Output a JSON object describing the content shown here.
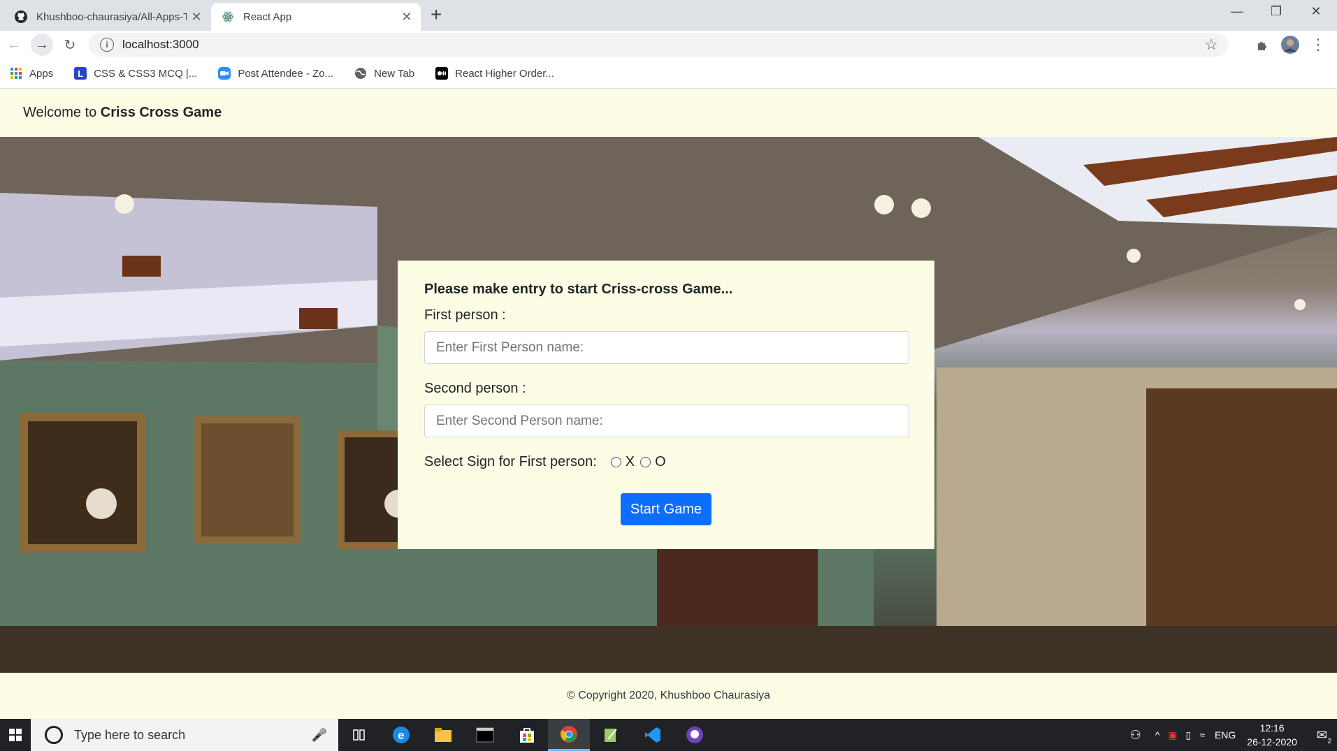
{
  "browser": {
    "tabs": [
      {
        "title": "Khushboo-chaurasiya/All-Apps-T",
        "active": false
      },
      {
        "title": "React App",
        "active": true
      }
    ],
    "url": "localhost:3000",
    "bookmarks": [
      {
        "label": "Apps",
        "icon": "apps-grid-icon"
      },
      {
        "label": "CSS & CSS3 MCQ |...",
        "icon": "l-logo-icon"
      },
      {
        "label": "Post Attendee - Zo...",
        "icon": "zoom-icon"
      },
      {
        "label": "New Tab",
        "icon": "globe-icon"
      },
      {
        "label": "React Higher Order...",
        "icon": "medium-icon"
      }
    ]
  },
  "header": {
    "welcome_prefix": "Welcome to ",
    "game_name": "Criss Cross Game"
  },
  "form": {
    "heading": "Please make entry to start Criss-cross Game...",
    "first_label": "First person :",
    "first_placeholder": "Enter First Person name:",
    "first_value": "",
    "second_label": "Second person :",
    "second_placeholder": "Enter Second Person name:",
    "second_value": "",
    "sign_label": "Select Sign for First person:",
    "sign_options": [
      "X",
      "O"
    ],
    "start_button": "Start Game"
  },
  "footer": {
    "copyright": "© Copyright 2020, Khushboo Chaurasiya"
  },
  "taskbar": {
    "search_placeholder": "Type here to search",
    "language": "ENG",
    "time": "12:16",
    "date": "26-12-2020",
    "notification_count": "2"
  },
  "colors": {
    "header_bg": "#fcfde4",
    "button_primary": "#0d6efd",
    "taskbar_bg": "#202225"
  }
}
